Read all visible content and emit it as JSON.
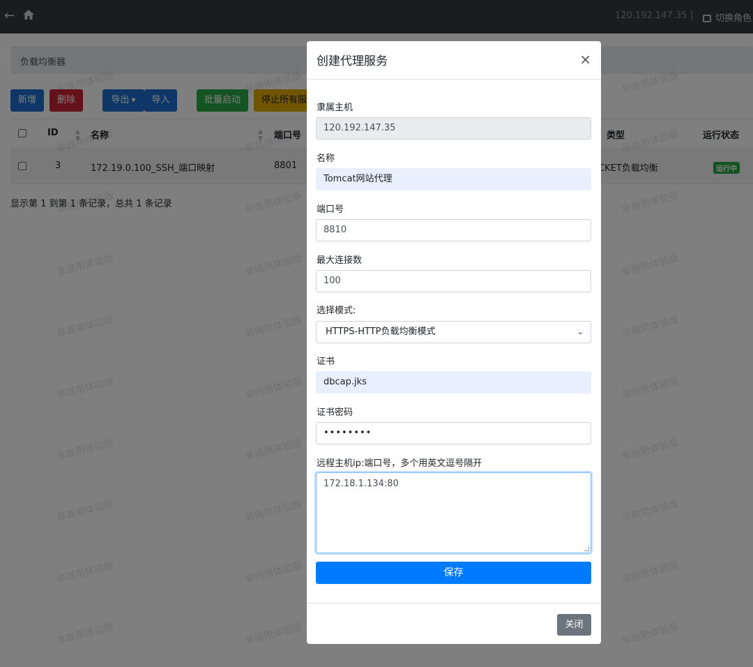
{
  "topbar": {
    "ip": "120.192.147.35",
    "separator": "|",
    "switch_role": "切换角色"
  },
  "breadcrumb": {
    "title": "负载均衡器"
  },
  "toolbar": {
    "add": "新增",
    "delete": "删除",
    "export": "导出",
    "import": "导入",
    "batch_start": "批量启动",
    "stop_all": "停止所有服"
  },
  "table": {
    "headers": {
      "id": "ID",
      "name": "名称",
      "port": "端口号",
      "type": "类型",
      "status": "运行状态"
    },
    "rows": [
      {
        "id": "3",
        "name": "172.19.0.100_SSH_端口映射",
        "port": "8801",
        "type": "CKET负载均衡",
        "status": "运行中"
      }
    ]
  },
  "pagination_text": "显示第 1 到第 1 条记录，总共 1 条记录",
  "watermark_text": "非商用体验版",
  "modal": {
    "title": "创建代理服务",
    "close_symbol": "×",
    "fields": {
      "host_label": "隶属主机",
      "host_value": "120.192.147.35",
      "name_label": "名称",
      "name_value": "Tomcat网站代理",
      "port_label": "端口号",
      "port_value": "8810",
      "maxconn_label": "最大连接数",
      "maxconn_value": "100",
      "mode_label": "选择模式:",
      "mode_value": "HTTPS-HTTP负载均衡模式",
      "cert_label": "证书",
      "cert_value": "dbcap.jks",
      "certpwd_label": "证书密码",
      "certpwd_value": "••••••••",
      "remote_label": "远程主机ip:端口号，多个用英文逗号隔开",
      "remote_value": "172.18.1.134:80"
    },
    "save": "保存",
    "close": "关闭"
  },
  "colors": {
    "topbar": "#343a40",
    "primary": "#007bff",
    "danger": "#c82333",
    "success": "#28a745",
    "warning": "#e0a800",
    "secondary": "#6c757d"
  }
}
